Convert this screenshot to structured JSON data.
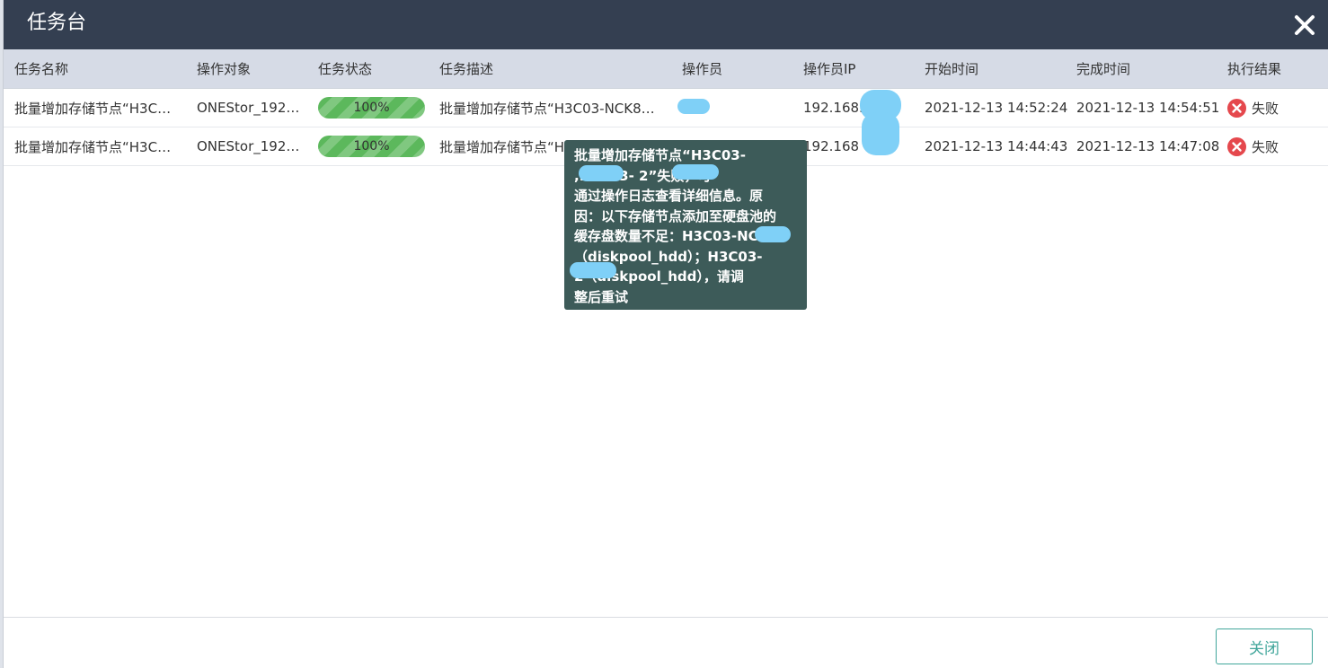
{
  "dialog": {
    "title": "任务台",
    "close_label": "关闭"
  },
  "columns": [
    "任务名称",
    "操作对象",
    "任务状态",
    "任务描述",
    "操作员",
    "操作员IP",
    "开始时间",
    "完成时间",
    "执行结果"
  ],
  "rows": [
    {
      "name": "批量增加存储节点“H3C…",
      "object": "ONEStor_192…",
      "progress": 100,
      "progress_label": "100%",
      "description": "批量增加存储节点“H3C03-NCK8…",
      "operator_ip": "192.168.",
      "start": "2021-12-13 14:52:24",
      "end": "2021-12-13 14:54:51",
      "result": "失败"
    },
    {
      "name": "批量增加存储节点“H3C…",
      "object": "ONEStor_192…",
      "progress": 100,
      "progress_label": "100%",
      "description": "批量增加存储节点“H",
      "operator_ip": "192.168",
      "start": "2021-12-13 14:44:43",
      "end": "2021-12-13 14:47:08",
      "result": "失败"
    }
  ],
  "tooltip": {
    "lines": [
      "批量增加存储节点“H3C03-",
      "      ,H3C03-       2”失败，可",
      "通过操作日志查看详细信息。原",
      "因：以下存储节点添加至硬盘池的",
      "缓存盘数量不足：H3C03-NC",
      "（diskpool_hdd）；H3C03-",
      "      2（diskpool_hdd），请调",
      "整后重试"
    ]
  },
  "colors": {
    "header_bg": "#343f51",
    "table_header_bg": "#d6dbe6",
    "progress_green": "#5cb85c",
    "fail_red": "#e5484d",
    "tooltip_bg": "#3d5b59",
    "button_teal": "#41a69b",
    "redaction": "#7fd0f7"
  },
  "icons": {
    "close": "close-x-icon",
    "fail": "fail-x-circle-icon"
  }
}
